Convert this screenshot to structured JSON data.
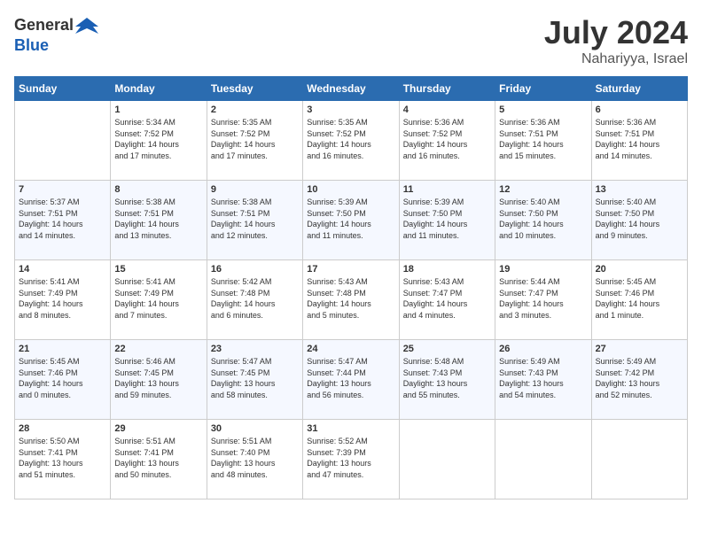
{
  "header": {
    "logo_line1": "General",
    "logo_line2": "Blue",
    "month": "July 2024",
    "location": "Nahariyya, Israel"
  },
  "columns": [
    "Sunday",
    "Monday",
    "Tuesday",
    "Wednesday",
    "Thursday",
    "Friday",
    "Saturday"
  ],
  "weeks": [
    [
      {
        "day": "",
        "info": ""
      },
      {
        "day": "1",
        "info": "Sunrise: 5:34 AM\nSunset: 7:52 PM\nDaylight: 14 hours\nand 17 minutes."
      },
      {
        "day": "2",
        "info": "Sunrise: 5:35 AM\nSunset: 7:52 PM\nDaylight: 14 hours\nand 17 minutes."
      },
      {
        "day": "3",
        "info": "Sunrise: 5:35 AM\nSunset: 7:52 PM\nDaylight: 14 hours\nand 16 minutes."
      },
      {
        "day": "4",
        "info": "Sunrise: 5:36 AM\nSunset: 7:52 PM\nDaylight: 14 hours\nand 16 minutes."
      },
      {
        "day": "5",
        "info": "Sunrise: 5:36 AM\nSunset: 7:51 PM\nDaylight: 14 hours\nand 15 minutes."
      },
      {
        "day": "6",
        "info": "Sunrise: 5:36 AM\nSunset: 7:51 PM\nDaylight: 14 hours\nand 14 minutes."
      }
    ],
    [
      {
        "day": "7",
        "info": "Sunrise: 5:37 AM\nSunset: 7:51 PM\nDaylight: 14 hours\nand 14 minutes."
      },
      {
        "day": "8",
        "info": "Sunrise: 5:38 AM\nSunset: 7:51 PM\nDaylight: 14 hours\nand 13 minutes."
      },
      {
        "day": "9",
        "info": "Sunrise: 5:38 AM\nSunset: 7:51 PM\nDaylight: 14 hours\nand 12 minutes."
      },
      {
        "day": "10",
        "info": "Sunrise: 5:39 AM\nSunset: 7:50 PM\nDaylight: 14 hours\nand 11 minutes."
      },
      {
        "day": "11",
        "info": "Sunrise: 5:39 AM\nSunset: 7:50 PM\nDaylight: 14 hours\nand 11 minutes."
      },
      {
        "day": "12",
        "info": "Sunrise: 5:40 AM\nSunset: 7:50 PM\nDaylight: 14 hours\nand 10 minutes."
      },
      {
        "day": "13",
        "info": "Sunrise: 5:40 AM\nSunset: 7:50 PM\nDaylight: 14 hours\nand 9 minutes."
      }
    ],
    [
      {
        "day": "14",
        "info": "Sunrise: 5:41 AM\nSunset: 7:49 PM\nDaylight: 14 hours\nand 8 minutes."
      },
      {
        "day": "15",
        "info": "Sunrise: 5:41 AM\nSunset: 7:49 PM\nDaylight: 14 hours\nand 7 minutes."
      },
      {
        "day": "16",
        "info": "Sunrise: 5:42 AM\nSunset: 7:48 PM\nDaylight: 14 hours\nand 6 minutes."
      },
      {
        "day": "17",
        "info": "Sunrise: 5:43 AM\nSunset: 7:48 PM\nDaylight: 14 hours\nand 5 minutes."
      },
      {
        "day": "18",
        "info": "Sunrise: 5:43 AM\nSunset: 7:47 PM\nDaylight: 14 hours\nand 4 minutes."
      },
      {
        "day": "19",
        "info": "Sunrise: 5:44 AM\nSunset: 7:47 PM\nDaylight: 14 hours\nand 3 minutes."
      },
      {
        "day": "20",
        "info": "Sunrise: 5:45 AM\nSunset: 7:46 PM\nDaylight: 14 hours\nand 1 minute."
      }
    ],
    [
      {
        "day": "21",
        "info": "Sunrise: 5:45 AM\nSunset: 7:46 PM\nDaylight: 14 hours\nand 0 minutes."
      },
      {
        "day": "22",
        "info": "Sunrise: 5:46 AM\nSunset: 7:45 PM\nDaylight: 13 hours\nand 59 minutes."
      },
      {
        "day": "23",
        "info": "Sunrise: 5:47 AM\nSunset: 7:45 PM\nDaylight: 13 hours\nand 58 minutes."
      },
      {
        "day": "24",
        "info": "Sunrise: 5:47 AM\nSunset: 7:44 PM\nDaylight: 13 hours\nand 56 minutes."
      },
      {
        "day": "25",
        "info": "Sunrise: 5:48 AM\nSunset: 7:43 PM\nDaylight: 13 hours\nand 55 minutes."
      },
      {
        "day": "26",
        "info": "Sunrise: 5:49 AM\nSunset: 7:43 PM\nDaylight: 13 hours\nand 54 minutes."
      },
      {
        "day": "27",
        "info": "Sunrise: 5:49 AM\nSunset: 7:42 PM\nDaylight: 13 hours\nand 52 minutes."
      }
    ],
    [
      {
        "day": "28",
        "info": "Sunrise: 5:50 AM\nSunset: 7:41 PM\nDaylight: 13 hours\nand 51 minutes."
      },
      {
        "day": "29",
        "info": "Sunrise: 5:51 AM\nSunset: 7:41 PM\nDaylight: 13 hours\nand 50 minutes."
      },
      {
        "day": "30",
        "info": "Sunrise: 5:51 AM\nSunset: 7:40 PM\nDaylight: 13 hours\nand 48 minutes."
      },
      {
        "day": "31",
        "info": "Sunrise: 5:52 AM\nSunset: 7:39 PM\nDaylight: 13 hours\nand 47 minutes."
      },
      {
        "day": "",
        "info": ""
      },
      {
        "day": "",
        "info": ""
      },
      {
        "day": "",
        "info": ""
      }
    ]
  ]
}
